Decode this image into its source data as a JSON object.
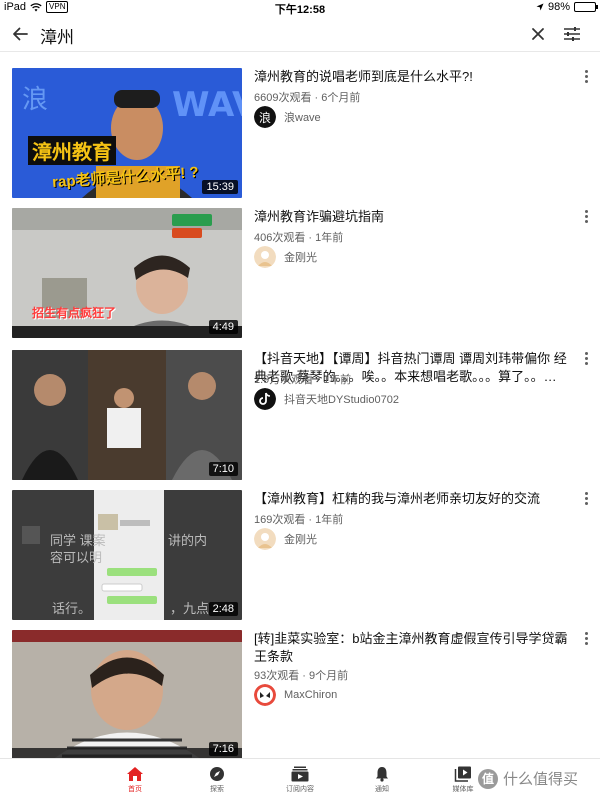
{
  "status_bar": {
    "device": "iPad",
    "vpn": "VPN",
    "time": "下午12:58",
    "battery": "98%",
    "battery_level": 0.98
  },
  "search": {
    "query": "漳州",
    "back_icon": "arrow-left-icon",
    "clear_icon": "close-icon",
    "filter_icon": "filter-sliders-icon"
  },
  "results": [
    {
      "title": "漳州教育的说唱老师到底是什么水平?!",
      "meta": "6609次观看 · 6个月前",
      "channel": "浪wave",
      "duration": "15:39",
      "thumb_text_1": "漳州教育",
      "thumb_text_2": "rap老师是什么水平! ?"
    },
    {
      "title": "漳州教育诈骗避坑指南",
      "meta": "406次观看 · 1年前",
      "channel": "金刚光",
      "duration": "4:49",
      "thumb_text_1": "招生有点疯狂了"
    },
    {
      "title": "【抖音天地】【谭周】抖音热门谭周 谭周刘玮带偏你 经典老歌 蔡琴的。。。唉。。本来想唱老歌。。。算了。。…",
      "meta": "1.9万次观看 · 1年前",
      "channel": "抖音天地DYStudio0702",
      "duration": "7:10"
    },
    {
      "title": "【漳州教育】杠精的我与漳州老师亲切友好的交流",
      "meta": "169次观看 · 1年前",
      "channel": "金刚光",
      "duration": "2:48",
      "thumb_text_1": "同学 课案",
      "thumb_text_2": "容可以明",
      "thumb_text_3": "话行。",
      "thumb_text_4": "讲的内",
      "thumb_text_5": "，九点"
    },
    {
      "title": "[转]韭菜实验室：b站金主漳州教育虚假宣传引导学贷霸王条款",
      "meta": "93次观看 · 9个月前",
      "channel": "MaxChiron",
      "duration": "7:16"
    }
  ],
  "bottom_nav": [
    {
      "label": "首页",
      "icon": "home-icon",
      "active": true
    },
    {
      "label": "探索",
      "icon": "compass-icon",
      "active": false
    },
    {
      "label": "订阅内容",
      "icon": "subscriptions-icon",
      "active": false
    },
    {
      "label": "通知",
      "icon": "bell-icon",
      "active": false
    },
    {
      "label": "媒体库",
      "icon": "library-icon",
      "active": false
    }
  ],
  "watermark": {
    "badge": "值",
    "text": "什么值得买"
  },
  "colors": {
    "accent_red": "#e32222",
    "meta_gray": "#606060"
  }
}
